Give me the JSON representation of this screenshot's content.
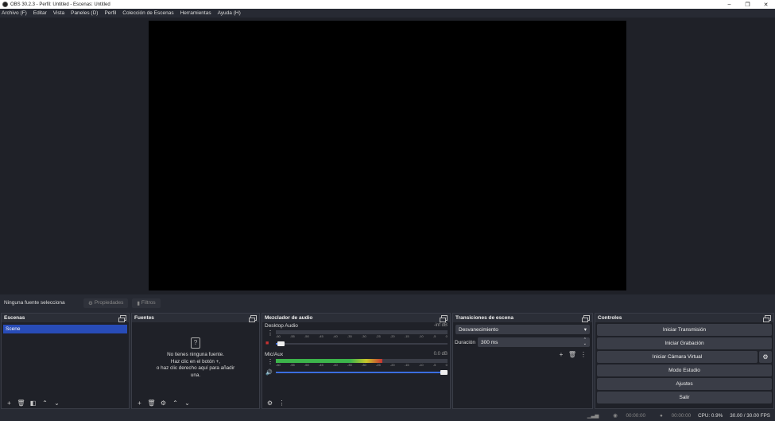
{
  "window": {
    "title": "OBS 30.2.3 - Perfil: Untitled - Escenas: Untitled",
    "minimize": "–",
    "restore": "❐",
    "close": "✕"
  },
  "menu": [
    "Archivo (F)",
    "Editar",
    "Vista",
    "Paneles (D)",
    "Perfil",
    "Colección de Escenas",
    "Herramientas",
    "Ayuda (H)"
  ],
  "context": {
    "no_source": "Ninguna fuente selecciona",
    "properties": "Propiedades",
    "filters": "Filtros"
  },
  "scenes": {
    "title": "Escenas",
    "items": [
      "Scene"
    ]
  },
  "sources": {
    "title": "Fuentes",
    "empty_lines": [
      "No tienes ninguna fuente.",
      "Haz clic en el botón +,",
      "o haz clic derecho aquí para añadir",
      "una."
    ]
  },
  "mixer": {
    "title": "Mezclador de audio",
    "ticks": [
      "-60",
      "-55",
      "-50",
      "-45",
      "-40",
      "-35",
      "-30",
      "-25",
      "-20",
      "-15",
      "-10",
      "-5",
      "0"
    ],
    "channels": [
      {
        "name": "Desktop Audio",
        "db": "-inf dB",
        "muted": true,
        "level": 0,
        "volume": 0.01
      },
      {
        "name": "Mic/Aux",
        "db": "0.0 dB",
        "muted": false,
        "level": 0.62,
        "volume": 1.0
      }
    ]
  },
  "transitions": {
    "title": "Transiciones de escena",
    "selected": "Desvanecimiento",
    "duration_label": "Duración",
    "duration_value": "300 ms"
  },
  "controls": {
    "title": "Controles",
    "start_stream": "Iniciar Transmisión",
    "start_record": "Iniciar Grabación",
    "start_vcam": "Iniciar Cámara Virtual",
    "studio_mode": "Modo Estudio",
    "settings": "Ajustes",
    "exit": "Salir"
  },
  "status": {
    "stream_time": "00:00:00",
    "rec_time": "00:00:00",
    "cpu": "CPU: 0.9%",
    "fps": "30.00 / 30.00 FPS"
  },
  "colors": {
    "accent": "#284cb8",
    "panel": "#1f2128",
    "bg": "#272a33",
    "meter_green": "#3cb44b",
    "meter_yellow": "#c8c82a",
    "meter_red": "#c83232"
  }
}
